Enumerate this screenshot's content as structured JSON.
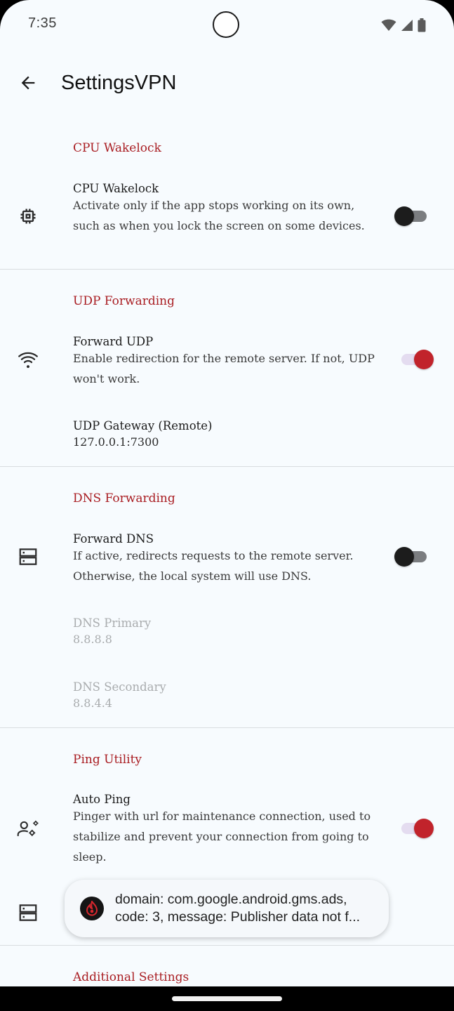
{
  "status_bar": {
    "time": "7:35"
  },
  "app_bar": {
    "title": "SettingsVPN"
  },
  "sections": {
    "cpu": {
      "category": "CPU Wakelock",
      "pref": {
        "title": "CPU Wakelock",
        "summary": "Activate only if the app stops working on its own, such as when you lock the screen on some devices.",
        "enabled": false
      }
    },
    "udp": {
      "category": "UDP Forwarding",
      "forward": {
        "title": "Forward UDP",
        "summary": "Enable redirection for the remote server. If not, UDP won't work.",
        "enabled": true
      },
      "gateway": {
        "title": "UDP Gateway (Remote)",
        "value": "127.0.0.1:7300"
      }
    },
    "dns": {
      "category": "DNS Forwarding",
      "forward": {
        "title": "Forward DNS",
        "summary": "If active, redirects requests to the remote server. Otherwise, the local system will use DNS.",
        "enabled": false
      },
      "primary": {
        "title": "DNS Primary",
        "value": "8.8.8.8"
      },
      "secondary": {
        "title": "DNS Secondary",
        "value": "8.8.4.4"
      }
    },
    "ping": {
      "category": "Ping Utility",
      "auto": {
        "title": "Auto Ping",
        "summary": "Pinger with url for maintenance connection, used to stabilize and prevent your connection from going to sleep.",
        "enabled": true
      }
    },
    "additional": {
      "category": "Additional Settings"
    }
  },
  "toast": {
    "line1": "domain: com.google.android.gms.ads,",
    "line2": "code: 3, message: Publisher data not f..."
  },
  "colors": {
    "accent": "#a91d22",
    "switch_on": "#c1232b",
    "background": "#f7fbfe"
  }
}
